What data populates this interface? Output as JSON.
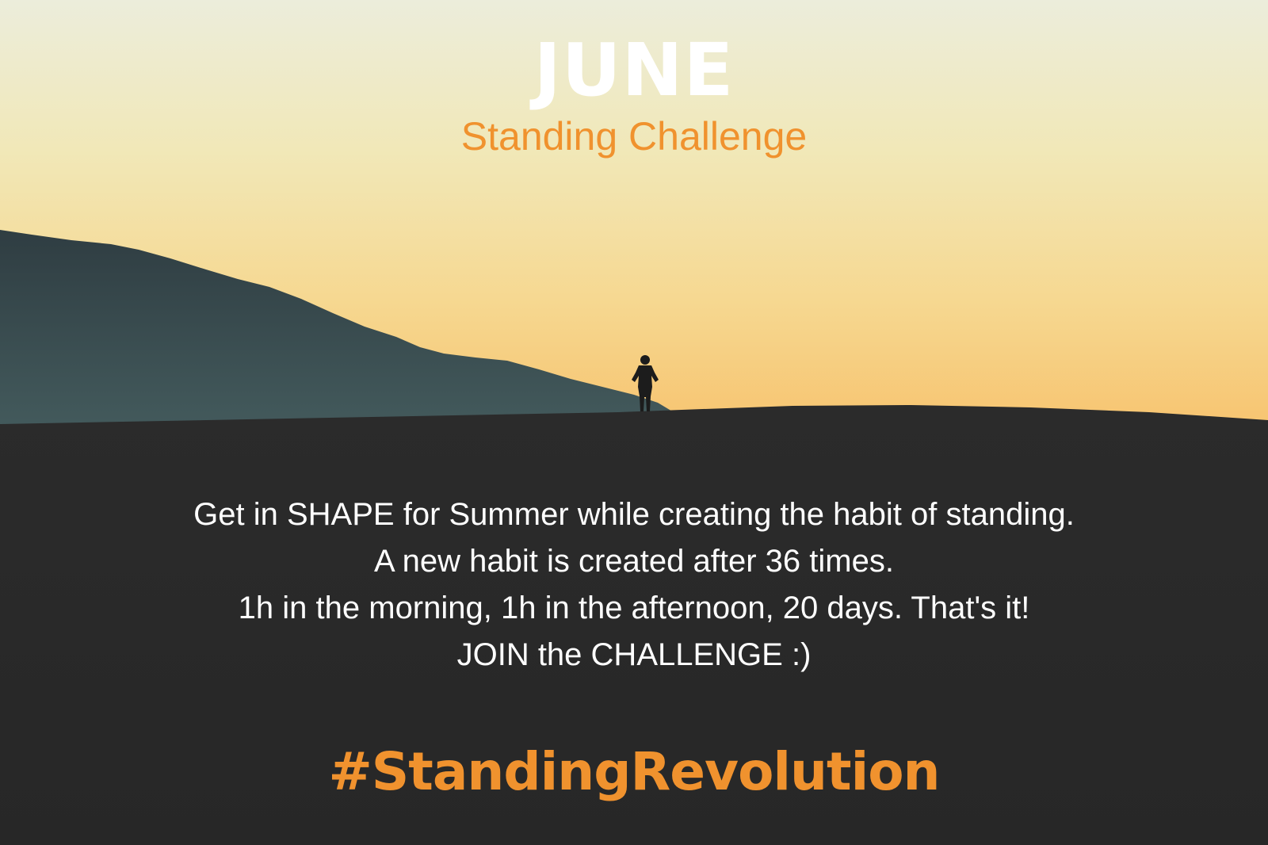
{
  "poster": {
    "title": "JUNE",
    "subtitle": "Standing Challenge",
    "body_lines": [
      "Get in SHAPE for Summer while creating the habit of standing.",
      "A new habit is created after 36 times.",
      "1h in the morning, 1h in the afternoon, 20 days. That's it!",
      "JOIN the CHALLENGE :)"
    ],
    "hashtag": "#StandingRevolution"
  },
  "colors": {
    "accent": "#f0922e",
    "text": "#ffffff",
    "sky_top": "#ecebd2",
    "sky_horizon": "#f6c877",
    "mountain": "#3a4b4e",
    "ground": "#2a2a2a"
  }
}
